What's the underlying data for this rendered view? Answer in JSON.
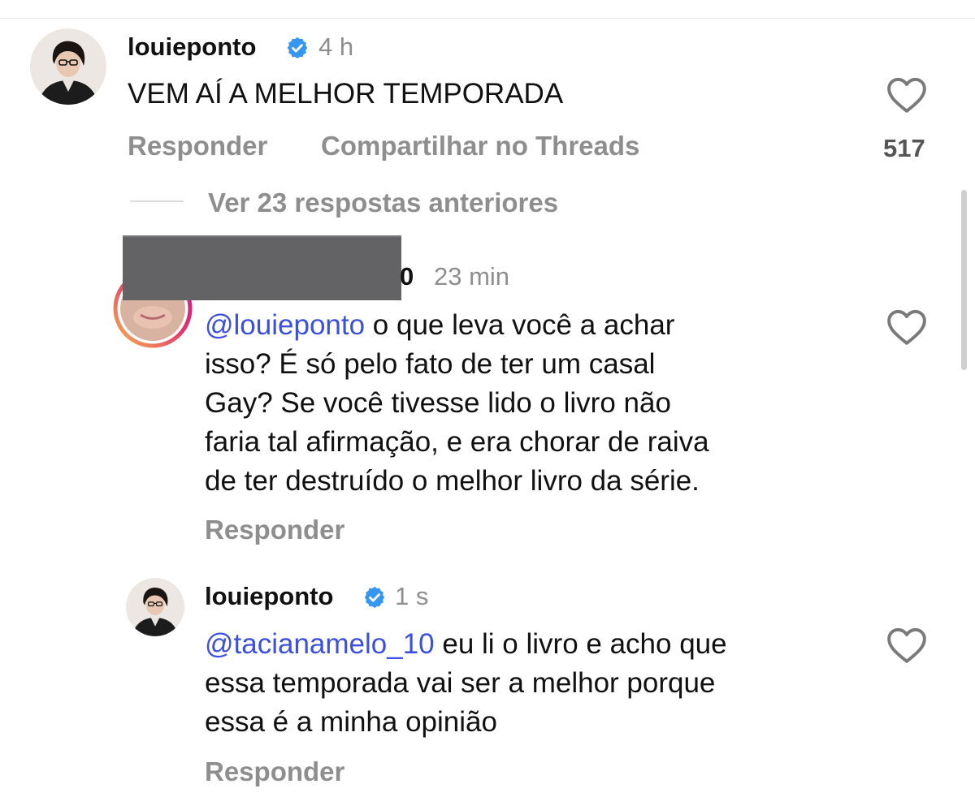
{
  "colors": {
    "mention": "#3b50e0",
    "secondary_text": "#8e8e8e",
    "verified": "#3797f0",
    "story_ring": [
      "#f9b14f",
      "#e2356c",
      "#c2198c"
    ]
  },
  "icons": {
    "like": "heart-outline-icon",
    "verified": "verified-badge-icon"
  },
  "comment": {
    "username": "louieponto",
    "time": "4 h",
    "text": "VEM AÍ A MELHOR TEMPORADA",
    "reply_label": "Responder",
    "share_label": "Compartilhar no Threads",
    "like_count": "517"
  },
  "view_replies": "Ver 23 respostas anteriores",
  "reply1": {
    "username_visible_fragment": "0",
    "time": "23 min",
    "mention": "@louieponto",
    "text_lines": [
      " o que leva você a achar",
      "isso? É só pelo fato de ter um casal",
      "Gay? Se você tivesse lido o livro não",
      "faria tal afirmação, e era chorar de raiva",
      "de ter destruído o melhor livro da série."
    ],
    "reply_label": "Responder"
  },
  "reply2": {
    "username": "louieponto",
    "time": "1 s",
    "mention": "@tacianamelo_10",
    "text_lines": [
      " eu li o livro e acho que",
      "essa temporada vai ser a melhor porque",
      "essa é a minha opinião"
    ],
    "reply_label": "Responder"
  }
}
